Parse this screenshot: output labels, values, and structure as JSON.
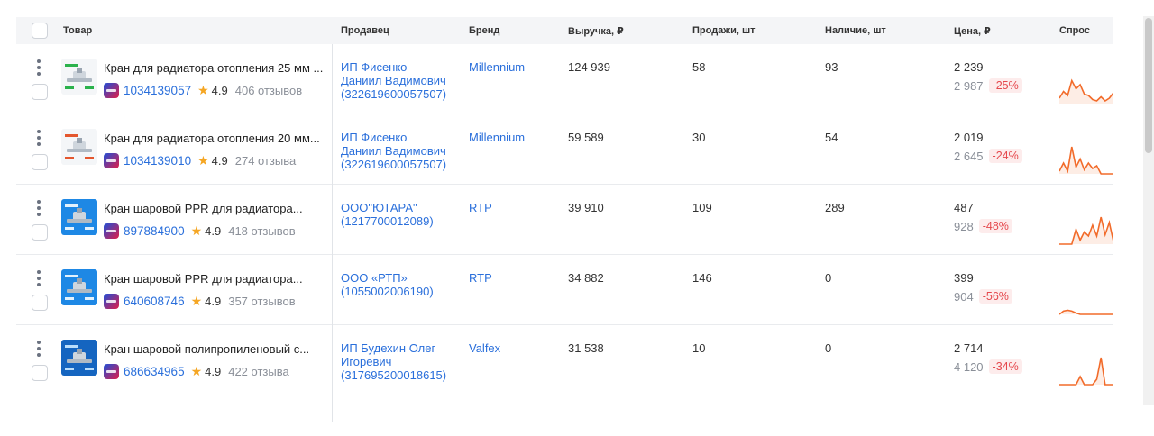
{
  "columns": {
    "product": "Товар",
    "seller": "Продавец",
    "brand": "Бренд",
    "revenue": "Выручка, ₽",
    "sales": "Продажи, шт",
    "stock": "Наличие, шт",
    "price": "Цена, ₽",
    "demand": "Спрос"
  },
  "rows": [
    {
      "title": "Кран для радиатора отопления 25 мм ...",
      "id": "1034139057",
      "rating": "4.9",
      "reviews": "406 отзывов",
      "seller": [
        "ИП Фисенко",
        "Даниил Вадимович",
        "(322619600057507)"
      ],
      "brand": "Millennium",
      "revenue": "124 939",
      "sales": "58",
      "stock": "93",
      "price": "2 239",
      "old_price": "2 987",
      "discount": "-25%",
      "demand": [
        0.2,
        0.45,
        0.3,
        0.85,
        0.55,
        0.7,
        0.35,
        0.3,
        0.15,
        0.1,
        0.25,
        0.1,
        0.2,
        0.4
      ]
    },
    {
      "title": "Кран для радиатора отопления 20 мм...",
      "id": "1034139010",
      "rating": "4.9",
      "reviews": "274 отзыва",
      "seller": [
        "ИП Фисенко",
        "Даниил Вадимович",
        "(322619600057507)"
      ],
      "brand": "Millennium",
      "revenue": "59 589",
      "sales": "30",
      "stock": "54",
      "price": "2 019",
      "old_price": "2 645",
      "discount": "-24%",
      "demand": [
        0.1,
        0.4,
        0.1,
        1.0,
        0.25,
        0.55,
        0.15,
        0.4,
        0.2,
        0.3,
        0.0,
        0.0,
        0.0,
        0.0
      ]
    },
    {
      "title": "Кран шаровой PPR для радиатора...",
      "id": "897884900",
      "rating": "4.9",
      "reviews": "418 отзывов",
      "seller": [
        "ООО\"ЮТАРА\"",
        "(1217700012089)"
      ],
      "brand": "RTP",
      "revenue": "39 910",
      "sales": "109",
      "stock": "289",
      "price": "487",
      "old_price": "928",
      "discount": "-48%",
      "demand": [
        0.0,
        0.0,
        0.0,
        0.0,
        0.55,
        0.15,
        0.45,
        0.3,
        0.7,
        0.3,
        1.0,
        0.35,
        0.8,
        0.1
      ]
    },
    {
      "title": "Кран шаровой PPR для радиатора...",
      "id": "640608746",
      "rating": "4.9",
      "reviews": "357 отзывов",
      "seller": [
        "ООО «РТП»",
        "(1055002006190)"
      ],
      "brand": "RTP",
      "revenue": "34 882",
      "sales": "146",
      "stock": "0",
      "price": "399",
      "old_price": "904",
      "discount": "-56%",
      "demand": [
        0.0,
        0.12,
        0.15,
        0.12,
        0.05,
        0.0,
        0.0,
        0.0,
        0.0,
        0.0,
        0.0,
        0.0,
        0.0,
        0.0
      ]
    },
    {
      "title": "Кран шаровой полипропиленовый с...",
      "id": "686634965",
      "rating": "4.9",
      "reviews": "422 отзыва",
      "seller": [
        "ИП Будехин Олег",
        "Игоревич",
        "(317695200018615)"
      ],
      "brand": "Valfex",
      "revenue": "31 538",
      "sales": "10",
      "stock": "0",
      "price": "2 714",
      "old_price": "4 120",
      "discount": "-34%",
      "demand": [
        0.0,
        0.0,
        0.0,
        0.0,
        0.0,
        0.3,
        0.0,
        0.0,
        0.0,
        0.2,
        1.0,
        0.0,
        0.0,
        0.0
      ]
    }
  ],
  "colors": {
    "link": "#2a6fdb",
    "spark_stroke": "#f26b2a",
    "discount_text": "#e5484d",
    "discount_bg": "#fdecec",
    "header_bg": "#f4f5f7"
  }
}
